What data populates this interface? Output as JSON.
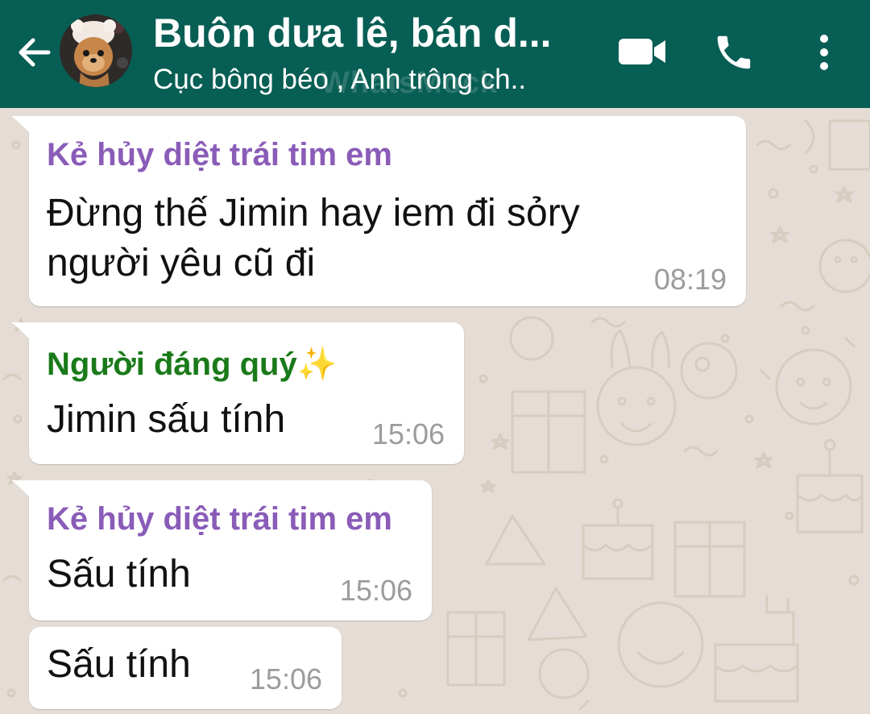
{
  "header": {
    "title": "Buôn dưa lê, bán d...",
    "subtitle": "Cục bông béo , Anh trông ch..",
    "watermark": "WhatsMock"
  },
  "colors": {
    "header_bg": "#075e54",
    "chat_bg": "#e5ddd5",
    "sender_purple": "#8a5cb8",
    "sender_green": "#1a7a1a",
    "time_gray": "#9c9c9c"
  },
  "icons": {
    "back": "arrow-left",
    "video": "video-camera",
    "call": "phone",
    "menu": "three-dots-vertical"
  },
  "messages": [
    {
      "sender": "Kẻ hủy diệt trái tim em",
      "line1": "Đừng thế Jimin hay iem đi sỏry",
      "line2": "người yêu cũ đi",
      "time": "08:19"
    },
    {
      "sender": "Người đáng quý",
      "sender_emoji": "✨",
      "line1": "Jimin sấu tính",
      "time": "15:06"
    },
    {
      "sender": "Kẻ hủy diệt trái tim em",
      "line1": "Sấu tính",
      "time": "15:06"
    },
    {
      "line1": "Sấu tính",
      "time": "15:06"
    }
  ]
}
